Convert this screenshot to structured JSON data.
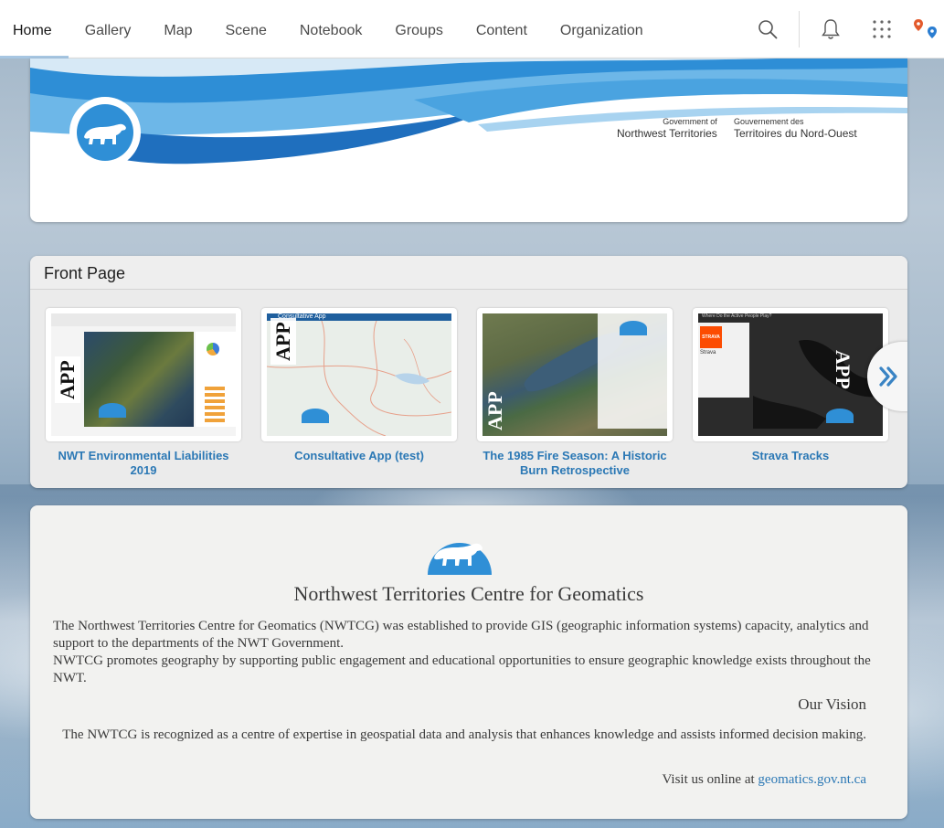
{
  "nav": {
    "items": [
      {
        "label": "Home",
        "active": true
      },
      {
        "label": "Gallery"
      },
      {
        "label": "Map"
      },
      {
        "label": "Scene"
      },
      {
        "label": "Notebook"
      },
      {
        "label": "Groups"
      },
      {
        "label": "Content"
      },
      {
        "label": "Organization"
      }
    ],
    "tools": [
      "search-icon",
      "bell-icon",
      "app-launcher-icon",
      "map-pins-icon"
    ]
  },
  "banner": {
    "gov_en_small": "Government of",
    "gov_en": "Northwest Territories",
    "gov_fr_small": "Gouvernement des",
    "gov_fr": "Territoires du Nord-Ouest"
  },
  "front_page": {
    "title": "Front Page",
    "app_label": "APP",
    "cards": [
      {
        "title": "NWT Environmental Liabilities 2019"
      },
      {
        "title": "Consultative App (test)"
      },
      {
        "title": "The 1985 Fire Season: A Historic Burn Retrospective"
      },
      {
        "title": "Strava Tracks"
      }
    ],
    "thumb_texts": {
      "consultative_header": "Consultative App",
      "strava_header": "Where Do the Active People Play?",
      "strava_logo": "STRAVA",
      "strava_name": "Strava"
    }
  },
  "about": {
    "title": "Northwest Territories Centre for Geomatics",
    "para1": "The Northwest Territories Centre for Geomatics (NWTCG) was established to provide GIS (geographic information systems) capacity, analytics and support to the departments of the NWT Government.",
    "para2": "NWTCG promotes geography by supporting public engagement and educational opportunities to ensure geographic knowledge exists throughout the NWT.",
    "vision_title": "Our Vision",
    "vision_text": "The NWTCG is recognized as a centre of expertise in geospatial data and analysis that enhances knowledge and assists informed decision making.",
    "visit_prefix": "Visit us online at",
    "visit_link": "geomatics.gov.nt.ca"
  },
  "colors": {
    "accent": "#2b78b5",
    "nav_active_underline": "#a7c6e2",
    "brand_blue": "#2f8fd6"
  }
}
